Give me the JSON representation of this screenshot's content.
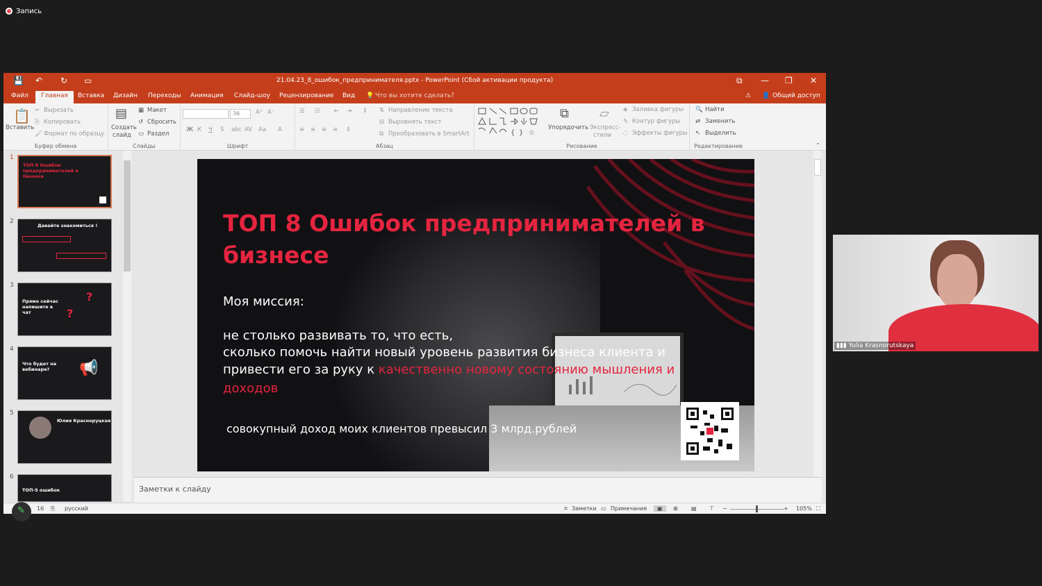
{
  "recording": {
    "label": "Запись"
  },
  "window": {
    "title": "21.04.23_8_ошибок_предпринимателя.pptx - PowerPoint (Сбой активации продукта)",
    "controls": {
      "restore": "⧉",
      "minimize": "—",
      "maximize": "❐",
      "close": "✕"
    }
  },
  "tabs": [
    "Файл",
    "Главная",
    "Вставка",
    "Дизайн",
    "Переходы",
    "Анимация",
    "Слайд-шоу",
    "Рецензирование",
    "Вид"
  ],
  "active_tab": "Главная",
  "tell_me": "Что вы хотите сделать?",
  "share": "Общий доступ",
  "ribbon": {
    "clipboard": {
      "paste": "Вставить",
      "cut": "Вырезать",
      "copy": "Копировать",
      "format": "Формат по образцу",
      "label": "Буфер обмена"
    },
    "slides": {
      "new": "Создать",
      "new2": "слайд",
      "layout": "Макет",
      "reset": "Сбросить",
      "section": "Раздел",
      "label": "Слайды"
    },
    "font": {
      "size": "36",
      "label": "Шрифт"
    },
    "paragraph": {
      "dir": "Направление текста",
      "align": "Выровнять текст",
      "smartart": "Преобразовать в SmartArt",
      "label": "Абзац"
    },
    "drawing": {
      "arrange": "Упорядочить",
      "quick": "Экспресс-",
      "quick2": "стили",
      "fill": "Заливка фигуры",
      "outline": "Контур фигуры",
      "effects": "Эффекты фигуры",
      "label": "Рисование"
    },
    "editing": {
      "find": "Найти",
      "replace": "Заменить",
      "select": "Выделить",
      "label": "Редактирование"
    }
  },
  "thumbs": [
    {
      "n": "1",
      "title": "ТОП 8 Ошибок предпринимателей в бизнесе"
    },
    {
      "n": "2",
      "title": "Давайте знакомиться !"
    },
    {
      "n": "3",
      "title": "Прямо сейчас напишите в чат"
    },
    {
      "n": "4",
      "title": "Что будет на вебинаре?"
    },
    {
      "n": "5",
      "title": "Юлия Красноруцкая"
    },
    {
      "n": "6",
      "title": "ТОП-5 ошибок"
    }
  ],
  "slide": {
    "title": "ТОП 8 Ошибок предпринимателей в бизнесе",
    "mission": "Моя миссия:",
    "line1": "не столько развивать то, что есть,",
    "line2": "сколько помочь найти новый уровень развития бизнеса клиента и",
    "line3_a": "привести его за руку к ",
    "line3_b": "качественно новому состоянию мышления и",
    "line4": "доходов",
    "income": "совокупный доход моих клиентов превысил 3 млрд.рублей",
    "accent": "#e5243f"
  },
  "notes": "Заметки к слайду",
  "status": {
    "slide": "16",
    "lang": "русский",
    "notes": "Заметки",
    "comments": "Примечания",
    "zoom": "105%"
  },
  "camera": {
    "name": "Yulia Krasnorutskaya"
  }
}
